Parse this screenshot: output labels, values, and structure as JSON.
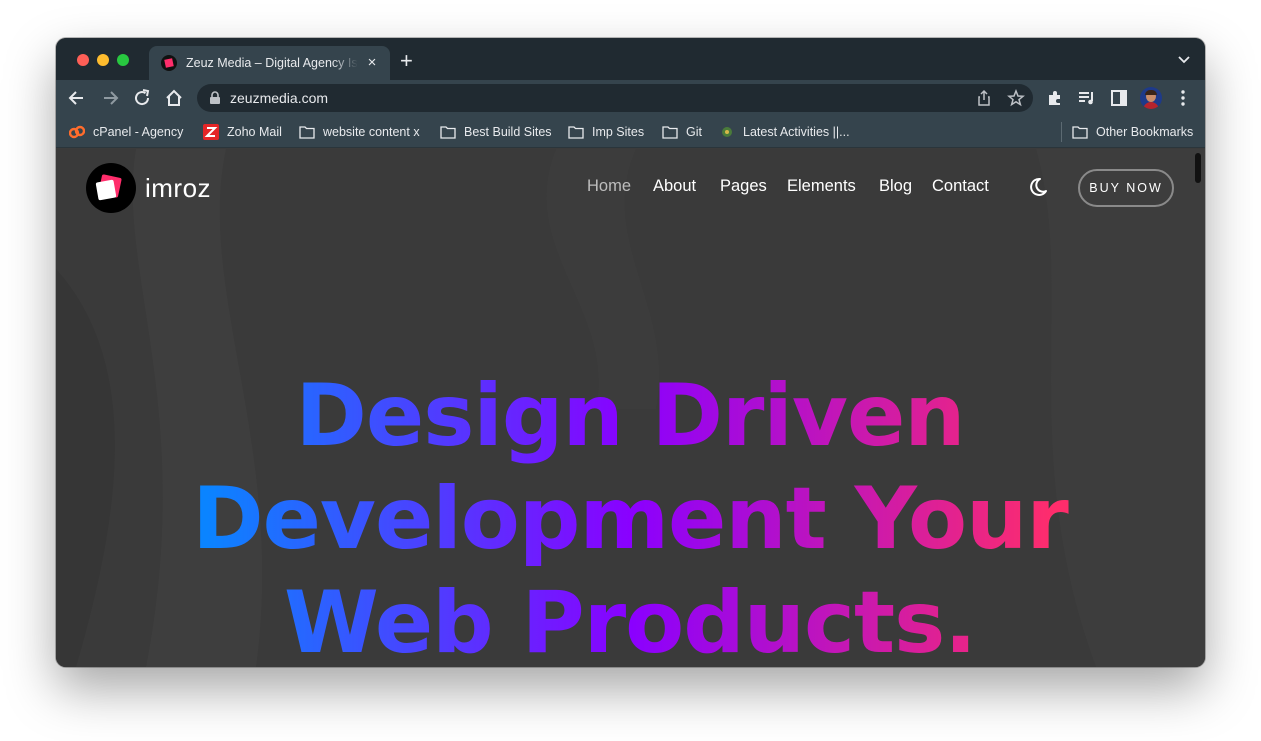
{
  "browser": {
    "tab": {
      "title": "Zeuz Media – Digital Agency Is",
      "close": "×"
    },
    "new_tab": "+",
    "url": "zeuzmedia.com",
    "bookmarks": [
      {
        "label": "cPanel - Agency",
        "icon": "cpanel-icon"
      },
      {
        "label": "Zoho Mail",
        "icon": "zoho-icon"
      },
      {
        "label": "website content x",
        "icon": "folder-icon"
      },
      {
        "label": "Best Build Sites",
        "icon": "folder-icon"
      },
      {
        "label": "Imp Sites",
        "icon": "folder-icon"
      },
      {
        "label": "Git",
        "icon": "folder-icon"
      },
      {
        "label": "Latest Activities ||...",
        "icon": "site-icon"
      }
    ],
    "other_bookmarks": "Other Bookmarks"
  },
  "site": {
    "logo_text": "imroz",
    "nav": [
      "Home",
      "About",
      "Pages",
      "Elements",
      "Blog",
      "Contact"
    ],
    "active_nav": "Home",
    "buy_button": "BUY NOW",
    "hero": {
      "line1": "Design Driven",
      "line2": "Development Your",
      "line3": "Web Products."
    }
  },
  "colors": {
    "hero_gradient": [
      "#0a84ff",
      "#8a00ff",
      "#ff2d6b"
    ],
    "page_bg": "#3a3a3a",
    "accent": "#ff2d6b"
  }
}
